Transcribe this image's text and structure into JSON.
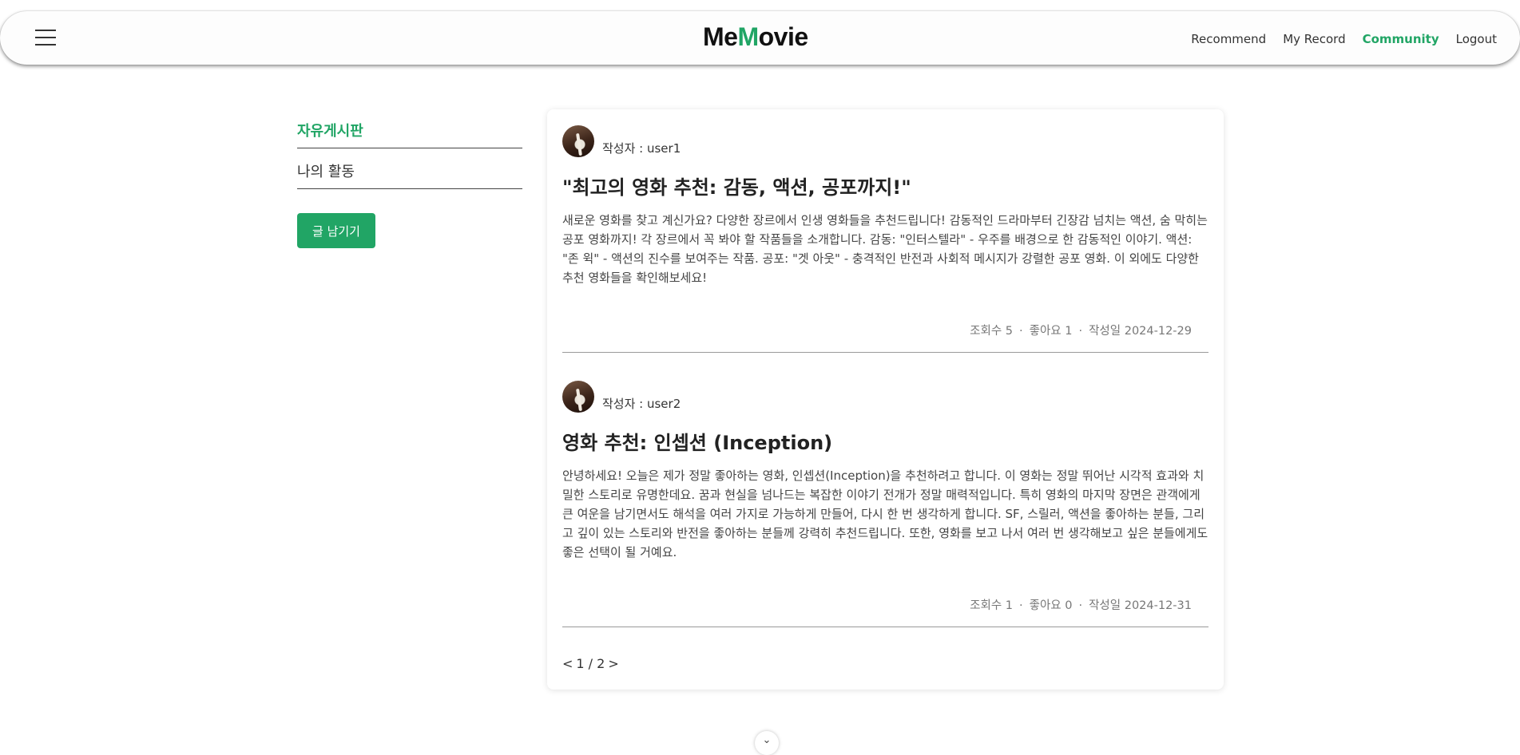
{
  "header": {
    "logo_part1": "Me",
    "logo_accent": "M",
    "logo_part2": "ovie",
    "nav": [
      {
        "label": "Recommend"
      },
      {
        "label": "My Record"
      },
      {
        "label": "Community"
      },
      {
        "label": "Logout"
      }
    ],
    "active_nav": "Community",
    "accent_color": "#21a565"
  },
  "sidebar": {
    "items": [
      {
        "label": "자유게시판"
      },
      {
        "label": "나의 활동"
      }
    ],
    "write_button": "글 남기기"
  },
  "posts": [
    {
      "author": "작성자 : user1",
      "title": "\"최고의 영화 추천: 감동, 액션, 공포까지!\"",
      "body": "새로운 영화를 찾고 계신가요? 다양한 장르에서 인생 영화들을 추천드립니다! 감동적인 드라마부터 긴장감 넘치는 액션, 숨 막히는 공포 영화까지! 각 장르에서 꼭 봐야 할 작품들을 소개합니다. 감동: \"인터스텔라\" - 우주를 배경으로 한 감동적인 이야기. 액션: \"존 윅\" - 액션의 진수를 보여주는 작품. 공포: \"겟 아웃\" - 충격적인 반전과 사회적 메시지가 강렬한 공포 영화. 이 외에도 다양한 추천 영화들을 확인해보세요!",
      "views": "조회수 5",
      "likes": "좋아요 1",
      "date": "작성일  2024-12-29"
    },
    {
      "author": "작성자 : user2",
      "title": "영화 추천: 인셉션 (Inception)",
      "body": "안녕하세요! 오늘은 제가 정말 좋아하는 영화, 인셉션(Inception)을 추천하려고 합니다. 이 영화는 정말 뛰어난 시각적 효과와 치밀한 스토리로 유명한데요. 꿈과 현실을 넘나드는 복잡한 이야기 전개가 정말 매력적입니다. 특히 영화의 마지막 장면은 관객에게 큰 여운을 남기면서도 해석을 여러 가지로 가능하게 만들어, 다시 한 번 생각하게 합니다. SF, 스릴러, 액션을 좋아하는 분들, 그리고 깊이 있는 스토리와 반전을 좋아하는 분들께 강력히 추천드립니다. 또한, 영화를 보고 나서 여러 번 생각해보고 싶은 분들에게도 좋은 선택이 될 거예요.",
      "views": "조회수 1",
      "likes": "좋아요 0",
      "date": "작성일  2024-12-31"
    }
  ],
  "pagination": {
    "prev": "<",
    "page": "1 / 2",
    "next": ">"
  },
  "scroll_indicator": "chevron-down-icon"
}
